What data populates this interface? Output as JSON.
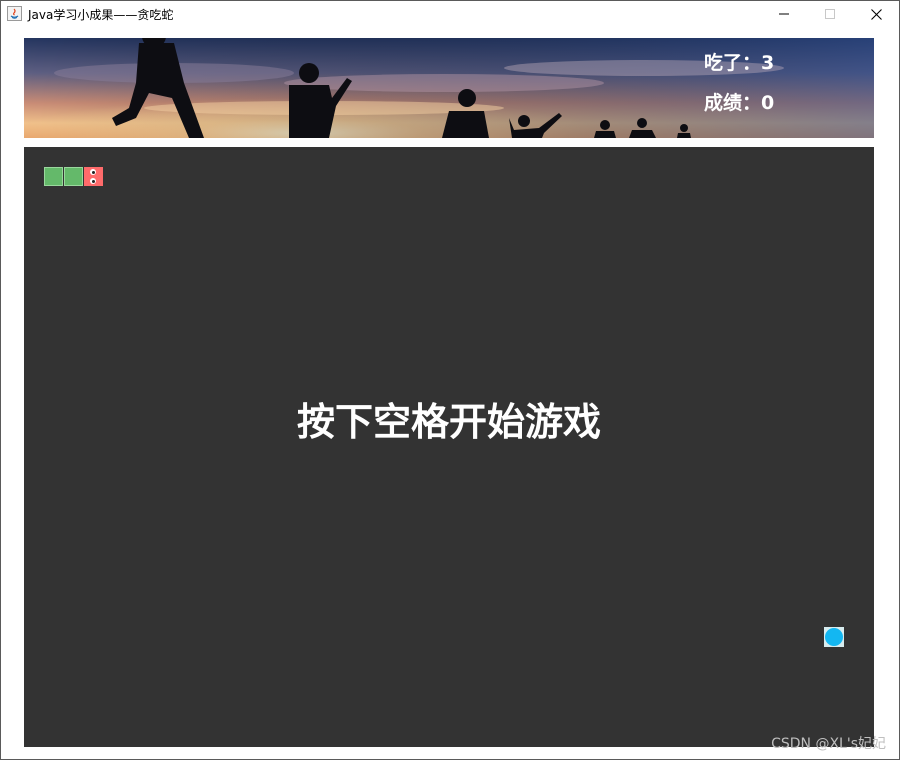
{
  "window": {
    "title": "Java学习小成果——贪吃蛇",
    "minimize_icon": "minimize-icon",
    "maximize_icon": "maximize-icon",
    "close_icon": "close-icon"
  },
  "header": {
    "eaten_label": "吃了：3",
    "score_label": "成绩：0",
    "background": "sunset-silhouette-photo"
  },
  "game": {
    "background_color": "#333333",
    "snake_body_color": "#64b96a",
    "snake_head_color": "#ff6b6b",
    "food_color": "#13b7f2",
    "message": "按下空格开始游戏",
    "snake_length": 3,
    "direction": "right"
  },
  "watermark": "CSDN @XL's妃妃"
}
